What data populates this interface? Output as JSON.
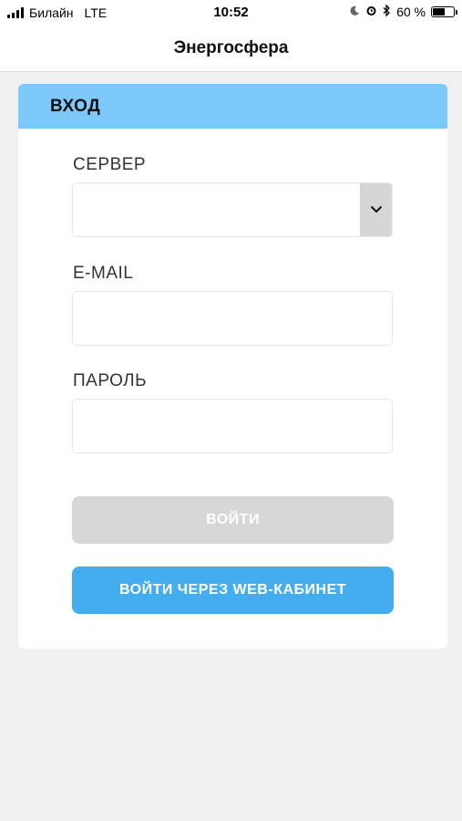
{
  "status_bar": {
    "carrier": "Билайн",
    "network": "LTE",
    "time": "10:52",
    "battery_percent": "60 %",
    "battery_level": 0.6,
    "icons": [
      "moon-icon",
      "alarm-icon",
      "bluetooth-icon"
    ]
  },
  "nav": {
    "title": "Энергосфера"
  },
  "login": {
    "header": "ВХОД",
    "server_label": "СЕРВЕР",
    "server_value": "",
    "email_label": "E-MAIL",
    "email_value": "",
    "password_label": "ПАРОЛЬ",
    "password_value": "",
    "login_button": "ВОЙТИ",
    "web_login_button": "ВОЙТИ ЧЕРЕЗ WEB-КАБИНЕТ"
  },
  "colors": {
    "header_bg": "#7ec9fb",
    "primary_button": "#43adf0",
    "disabled_button": "#d7d7d7",
    "page_bg": "#f0f0f0"
  }
}
